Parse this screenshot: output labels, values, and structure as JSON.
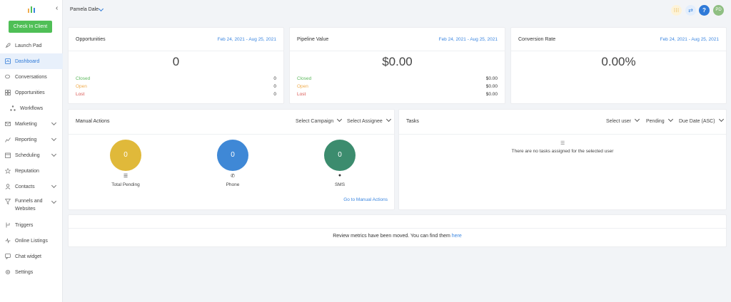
{
  "sidebar": {
    "checkin_label": "Check In Client",
    "items": [
      {
        "label": "Launch Pad",
        "icon": "rocket-icon",
        "has_chevron": false,
        "active": false
      },
      {
        "label": "Dashboard",
        "icon": "dashboard-icon",
        "has_chevron": false,
        "active": true
      },
      {
        "label": "Conversations",
        "icon": "chat-bubbles-icon",
        "has_chevron": false,
        "active": false
      },
      {
        "label": "Opportunities",
        "icon": "funnel-board-icon",
        "has_chevron": false,
        "active": false
      },
      {
        "label": "Workflows",
        "icon": "workflow-icon",
        "has_chevron": false,
        "active": false
      },
      {
        "label": "Marketing",
        "icon": "envelope-icon",
        "has_chevron": true,
        "active": false
      },
      {
        "label": "Reporting",
        "icon": "chart-icon",
        "has_chevron": true,
        "active": false
      },
      {
        "label": "Scheduling",
        "icon": "calendar-icon",
        "has_chevron": true,
        "active": false
      },
      {
        "label": "Reputation",
        "icon": "star-icon",
        "has_chevron": false,
        "active": false
      },
      {
        "label": "Contacts",
        "icon": "person-icon",
        "has_chevron": true,
        "active": false
      },
      {
        "label": "Funnels and Websites",
        "icon": "filter-icon",
        "has_chevron": true,
        "active": false
      },
      {
        "label": "Triggers",
        "icon": "trigger-icon",
        "has_chevron": false,
        "active": false
      },
      {
        "label": "Online Listings",
        "icon": "pulse-icon",
        "has_chevron": false,
        "active": false
      },
      {
        "label": "Chat widget",
        "icon": "chat-icon",
        "has_chevron": false,
        "active": false
      },
      {
        "label": "Settings",
        "icon": "gear-icon",
        "has_chevron": false,
        "active": false
      }
    ]
  },
  "topbar": {
    "user_name": "Pamela Dale",
    "avatar_initials": "PD",
    "help_label": "?"
  },
  "opportunities": {
    "title": "Opportunities",
    "date_range": "Feb 24, 2021 - Aug 25, 2021",
    "total": "0",
    "closed_label": "Closed",
    "closed_value": "0",
    "open_label": "Open",
    "open_value": "0",
    "lost_label": "Lost",
    "lost_value": "0"
  },
  "pipeline": {
    "title": "Pipeline Value",
    "date_range": "Feb 24, 2021 - Aug 25, 2021",
    "total": "$0.00",
    "closed_label": "Closed",
    "closed_value": "$0.00",
    "open_label": "Open",
    "open_value": "$0.00",
    "lost_label": "Lost",
    "lost_value": "$0.00"
  },
  "conversion": {
    "title": "Conversion Rate",
    "date_range": "Feb 24, 2021 - Aug 25, 2021",
    "total": "0.00%"
  },
  "manual_actions": {
    "title": "Manual Actions",
    "campaign_dropdown": "Select Campaign",
    "assignee_dropdown": "Select Assignee",
    "total_pending_value": "0",
    "total_pending_label": "Total Pending",
    "phone_value": "0",
    "phone_label": "Phone",
    "sms_value": "0",
    "sms_label": "SMS",
    "go_link": "Go to Manual Actions"
  },
  "tasks": {
    "title": "Tasks",
    "user_dropdown": "Select user",
    "status_dropdown": "Pending",
    "sort_dropdown": "Due Date (ASC)",
    "empty_text": "There are no tasks assigned for the selected user"
  },
  "review_notice": {
    "text": "Review metrics have been moved. You can find them",
    "link": "here"
  },
  "colors": {
    "accent": "#3b86e0",
    "green": "#4fbf56",
    "closed": "#5cb85c",
    "open": "#f0ad4e",
    "lost": "#d9534f",
    "pending_circle": "#e0b93a",
    "phone_circle": "#3f88d6",
    "sms_circle": "#3c8c6e"
  }
}
